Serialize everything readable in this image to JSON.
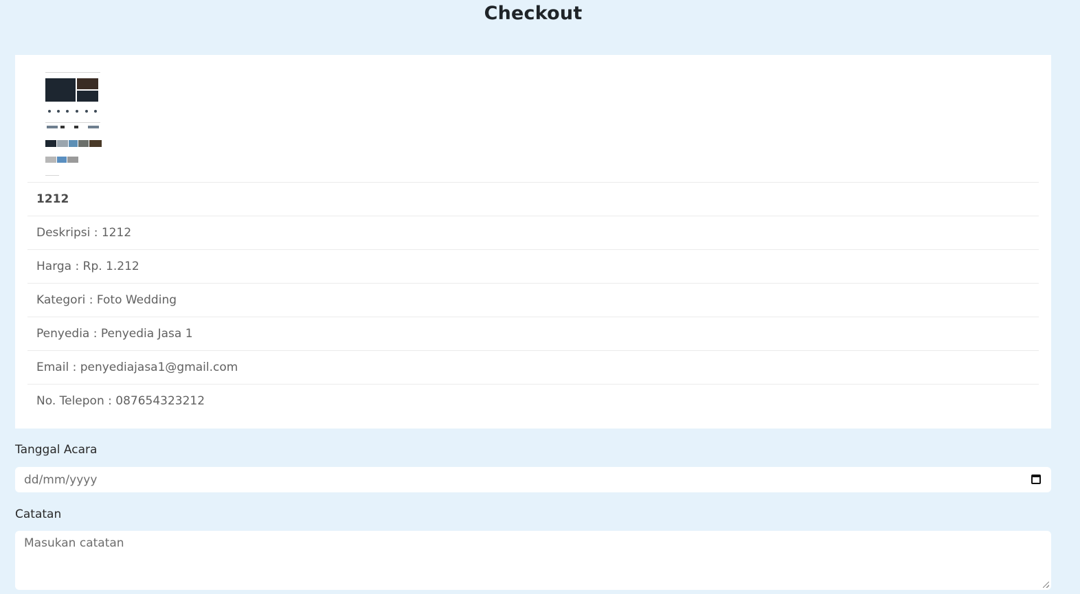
{
  "page": {
    "title": "Checkout"
  },
  "product": {
    "image_icon": "product-screenshot-thumbnail",
    "name": "1212",
    "details": [
      "Deskripsi : 1212",
      "Harga : Rp. 1.212",
      "Kategori : Foto Wedding",
      "Penyedia : Penyedia Jasa 1",
      "Email : penyediajasa1@gmail.com",
      "No. Telepon : 087654323212"
    ]
  },
  "form": {
    "event_date": {
      "label": "Tanggal Acara",
      "placeholder": "dd/mm/yyyy",
      "icon": "calendar-icon"
    },
    "notes": {
      "label": "Catatan",
      "placeholder": "Masukan catatan"
    }
  },
  "colors": {
    "background": "#e5f2fb",
    "card": "#ffffff",
    "title": "#1f2428",
    "text": "#616161"
  }
}
